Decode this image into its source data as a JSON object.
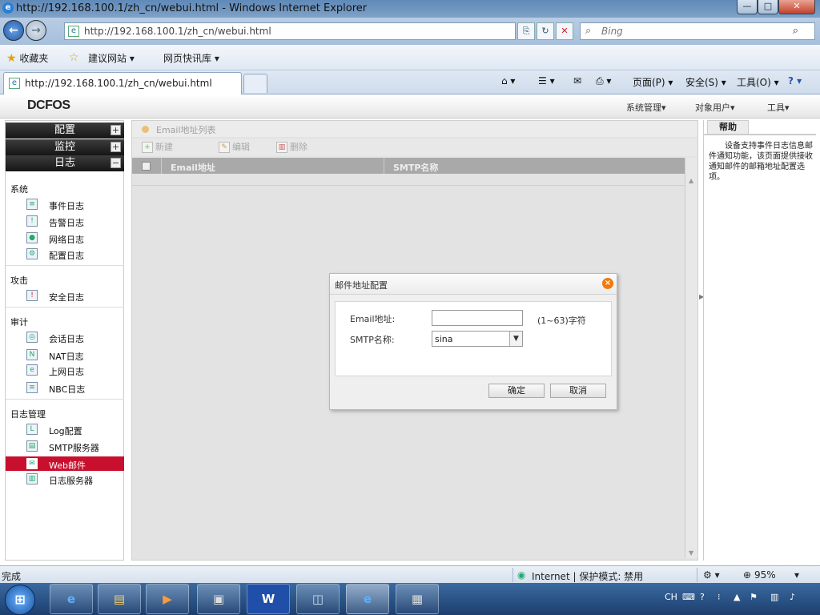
{
  "window": {
    "title": "http://192.168.100.1/zh_cn/webui.html - Windows Internet Explorer",
    "min": "—",
    "max": "□",
    "close": "✕"
  },
  "address": {
    "url": "http://192.168.100.1/zh_cn/webui.html"
  },
  "search": {
    "placeholder": "Bing"
  },
  "favorites": {
    "label": "收藏夹",
    "items": [
      "建议网站",
      "网页快讯库"
    ]
  },
  "tab": {
    "title": "http://192.168.100.1/zh_cn/webui.html"
  },
  "commands": {
    "page": "页面(P)",
    "safety": "安全(S)",
    "tools": "工具(O)"
  },
  "app": {
    "logo": "DCFOS",
    "topmenu": [
      "系统管理",
      "对象用户",
      "工具"
    ]
  },
  "sidebar": {
    "accordions": [
      "配置",
      "监控",
      "日志"
    ],
    "groups": [
      {
        "label": "系统",
        "items": [
          "事件日志",
          "告警日志",
          "网络日志",
          "配置日志"
        ]
      },
      {
        "label": "攻击",
        "items": [
          "安全日志"
        ]
      },
      {
        "label": "审计",
        "items": [
          "会话日志",
          "NAT日志",
          "上网日志",
          "NBC日志"
        ]
      },
      {
        "label": "日志管理",
        "items": [
          "Log配置",
          "SMTP服务器",
          "Web邮件",
          "日志服务器"
        ]
      }
    ],
    "active": "Web邮件"
  },
  "list": {
    "title": "Email地址列表",
    "toolbar": [
      "新建",
      "编辑",
      "删除"
    ],
    "columns": [
      "Email地址",
      "SMTP名称"
    ]
  },
  "help": {
    "tab": "帮助",
    "text": "设备支持事件日志信息邮件通知功能，该页面提供接收通知邮件的邮箱地址配置选项。"
  },
  "dialog": {
    "title": "邮件地址配置",
    "email_label": "Email地址:",
    "email_value": "",
    "email_hint": "(1~63)字符",
    "smtp_label": "SMTP名称:",
    "smtp_value": "sina",
    "ok": "确定",
    "cancel": "取消"
  },
  "status": {
    "left": "完成",
    "zone": "Internet | 保护模式: 禁用",
    "zoom": "95%"
  },
  "taskbar": {
    "ime": "CH"
  }
}
